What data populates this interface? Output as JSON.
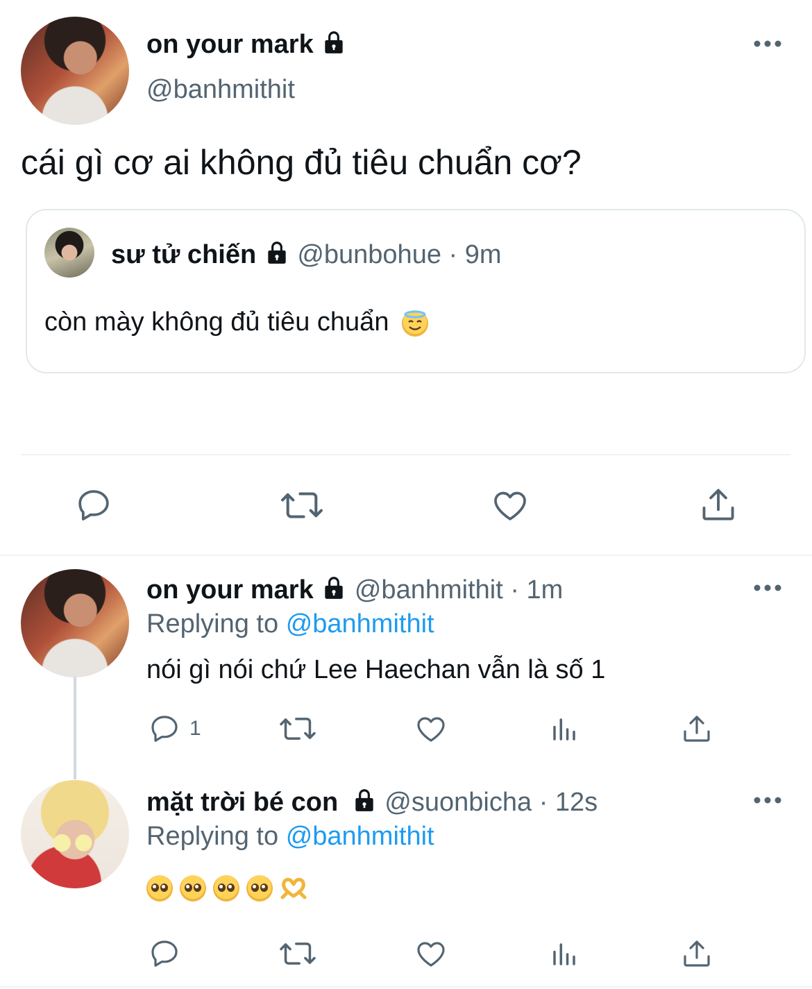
{
  "main_tweet": {
    "display_name": "on your mark",
    "handle": "@banhmithit",
    "text": "cái gì cơ ai không đủ tiêu chuẩn cơ?",
    "more_icon": "more-horizontal-icon",
    "quoted": {
      "display_name": "sư tử chiến",
      "handle": "@bunbohue",
      "time": "· 9m",
      "text": "còn mày không đủ tiêu chuẩn",
      "emoji": "smiling-face-with-halo"
    },
    "actions": {
      "reply_icon": "reply-icon",
      "retweet_icon": "retweet-icon",
      "like_icon": "like-icon",
      "share_icon": "share-icon"
    }
  },
  "replies": [
    {
      "display_name": "on your mark",
      "handle": "@banhmithit",
      "time": "· 1m",
      "replying_prefix": "Replying to",
      "replying_handle": "@banhmithit",
      "text": "nói gì nói chứ Lee Haechan vẫn là số 1",
      "reply_count": "1"
    },
    {
      "display_name": "mặt trời bé con",
      "handle": "@suonbicha",
      "time": "· 12s",
      "replying_prefix": "Replying to",
      "replying_handle": "@banhmithit",
      "emojis": [
        "pleading-face",
        "pleading-face",
        "pleading-face",
        "pleading-face",
        "heart-hands"
      ]
    }
  ],
  "colors": {
    "text": "#0f1419",
    "secondary": "#536471",
    "accent": "#1d9bf0",
    "divider": "#eff3f4"
  }
}
